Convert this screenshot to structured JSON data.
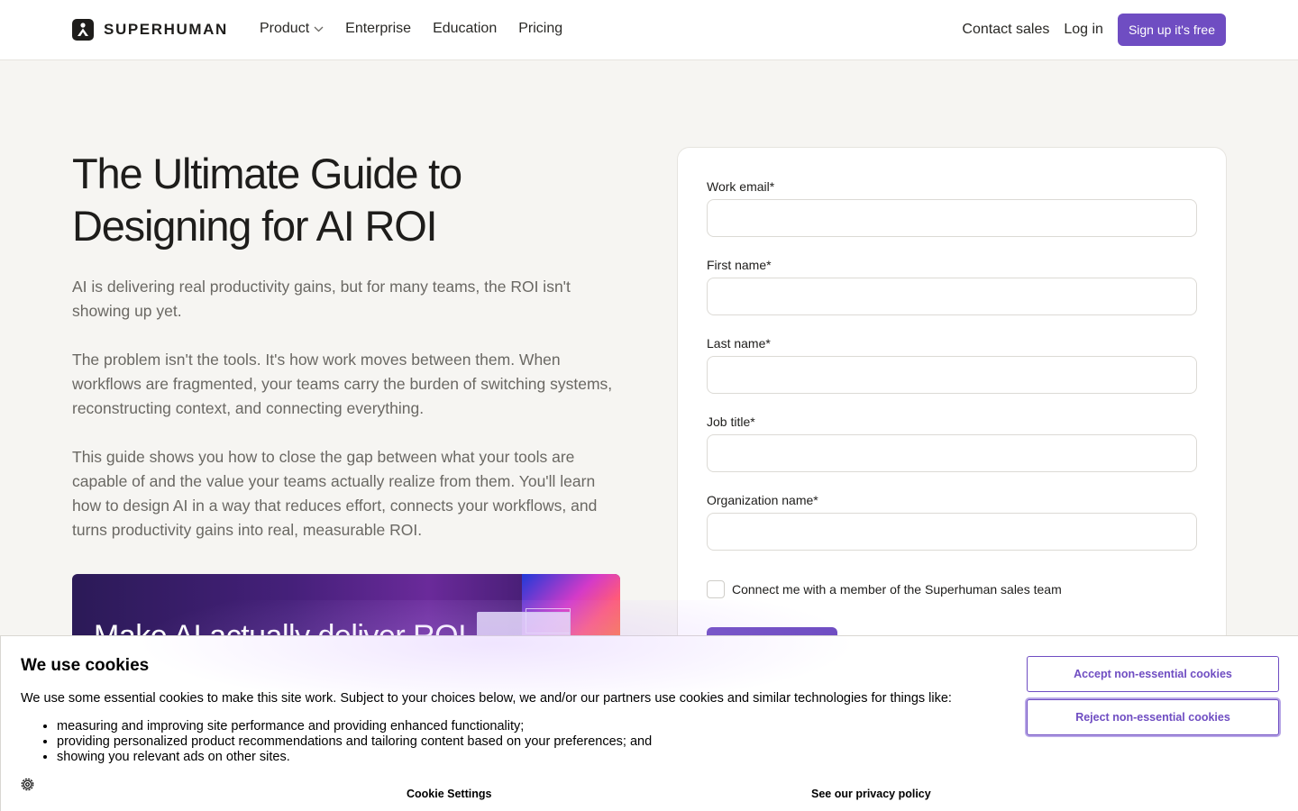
{
  "header": {
    "brand": "SUPERHUMAN",
    "nav": [
      {
        "label": "Product",
        "icon": "chevron-down-icon"
      },
      {
        "label": "Enterprise"
      },
      {
        "label": "Education"
      },
      {
        "label": "Pricing"
      }
    ],
    "contact_sales": "Contact sales",
    "login": "Log in",
    "signup": "Sign up it's free"
  },
  "hero": {
    "title_line1": "The Ultimate Guide to",
    "title_line2": "Designing for AI ROI",
    "paragraphs": [
      "AI is delivering real productivity gains, but for many teams, the ROI isn't showing up yet.",
      "The problem isn't the tools. It's how work moves between them. When workflows are fragmented, your teams carry the burden of switching systems, reconstructing context, and connecting everything.",
      "This guide shows you how to close the gap between what your tools are capable of and the value your teams actually realize from them. You'll learn how to design AI in a way that reduces effort, connects your workflows, and turns productivity gains into real, measurable ROI."
    ],
    "banner_text": "Make AI actually deliver ROI"
  },
  "form": {
    "fields": [
      {
        "label": "Work email*",
        "value": "",
        "placeholder": ""
      },
      {
        "label": "First name*",
        "value": "",
        "placeholder": ""
      },
      {
        "label": "Last name*",
        "value": "",
        "placeholder": ""
      },
      {
        "label": "Job title*",
        "value": "",
        "placeholder": ""
      },
      {
        "label": "Organization name*",
        "value": "",
        "placeholder": ""
      }
    ],
    "checkbox_label": "Connect me with a member of the Superhuman sales team",
    "checkbox_checked": false
  },
  "cookie": {
    "title": "We use cookies",
    "intro": "We use some essential cookies to make this site work. Subject to your choices below, we and/or our partners use cookies and similar technologies for things like:",
    "items": [
      "measuring and improving site performance and providing enhanced functionality;",
      "providing personalized product recommendations and tailoring content based on your preferences; and",
      "showing you relevant ads on other sites."
    ],
    "accept": "Accept non-essential cookies",
    "reject": "Reject non-essential cookies",
    "settings": "Cookie Settings",
    "privacy": "See our privacy policy"
  },
  "colors": {
    "accent": "#6f4dc2",
    "background": "#f6f5f2",
    "text": "#1e1d1b",
    "muted_text": "#6a6863"
  }
}
